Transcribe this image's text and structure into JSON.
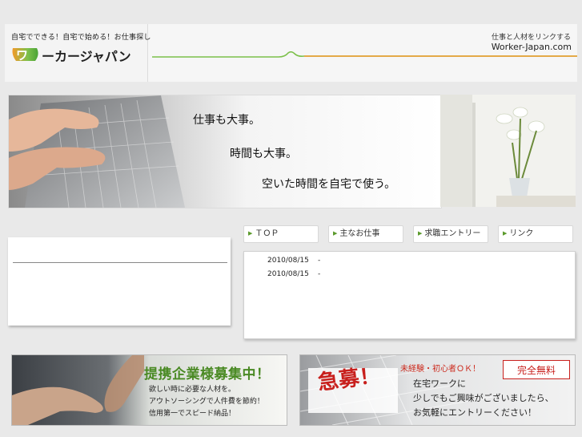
{
  "header": {
    "logo_tagline": "自宅でできる！自宅で始める！お仕事探し",
    "logo_text": "ーカージャパン",
    "slogan": "仕事と人材をリンクする",
    "domain": "Worker-Japan.com"
  },
  "banner": {
    "copy": [
      "仕事も大事。",
      "時間も大事。",
      "空いた時間を自宅で使う。"
    ]
  },
  "nav": {
    "tabs": [
      {
        "label": "ＴＯＰ"
      },
      {
        "label": "主なお仕事"
      },
      {
        "label": "求職エントリー"
      },
      {
        "label": "リンク"
      }
    ]
  },
  "news": {
    "items": [
      {
        "date": "2010/08/15",
        "separator": "-"
      },
      {
        "date": "2010/08/15",
        "separator": "-"
      }
    ]
  },
  "partner_banner": {
    "title": "提携企業様募集中！",
    "lines": [
      "欲しい時に必要な人材を。",
      "アウトソーシングで人件費を節約！",
      "信用第一でスピード納品！"
    ]
  },
  "recruit_banner": {
    "headline": "急募！",
    "sub": "未経験・初心者ＯＫ！",
    "badge": "完全無料",
    "lines": [
      "在宅ワークに",
      "少しでもご興味がございましたら、",
      "お気軽にエントリーください！"
    ]
  },
  "colors": {
    "accent_green": "#5a9a2a",
    "accent_orange": "#f39a2a",
    "recruit_red": "#c8201d"
  }
}
